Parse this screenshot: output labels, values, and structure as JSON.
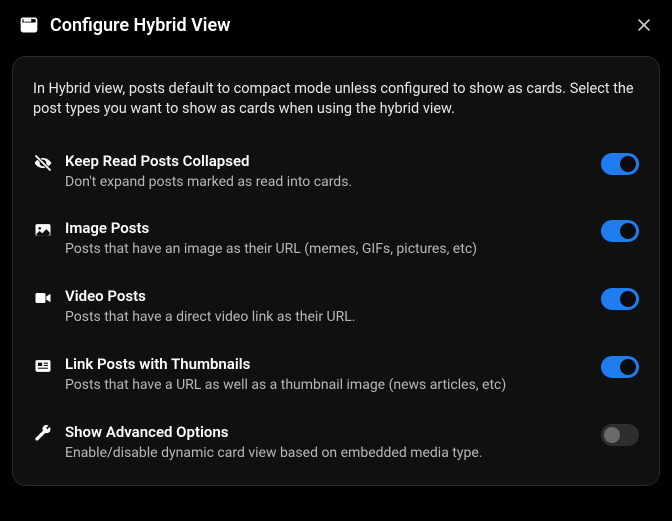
{
  "header": {
    "title": "Configure Hybrid View"
  },
  "intro": "In Hybrid view, posts default to compact mode unless configured to show as cards. Select the post types you want to show as cards when using the hybrid view.",
  "options": {
    "keep_read": {
      "label": "Keep Read Posts Collapsed",
      "desc": "Don't expand posts marked as read into cards.",
      "enabled": true
    },
    "image": {
      "label": "Image Posts",
      "desc": "Posts that have an image as their URL (memes, GIFs, pictures, etc)",
      "enabled": true
    },
    "video": {
      "label": "Video Posts",
      "desc": "Posts that have a direct video link as their URL.",
      "enabled": true
    },
    "link": {
      "label": "Link Posts with Thumbnails",
      "desc": "Posts that have a URL as well as a thumbnail image (news articles, etc)",
      "enabled": true
    },
    "advanced": {
      "label": "Show Advanced Options",
      "desc": "Enable/disable dynamic card view based on embedded media type.",
      "enabled": false
    }
  }
}
